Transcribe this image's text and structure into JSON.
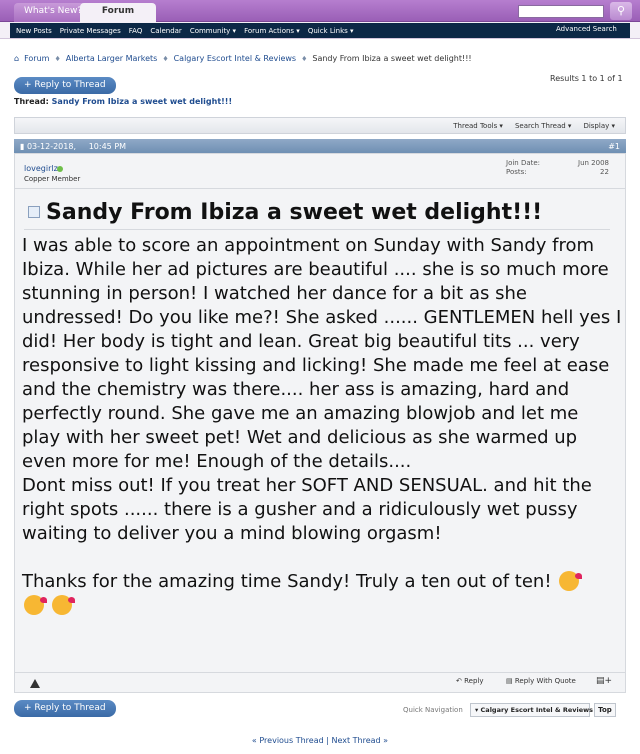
{
  "topbar": {
    "whats_new": "What's New?",
    "forum_tab": "Forum",
    "search_icon": "search-icon"
  },
  "subnav": {
    "items": [
      "New Posts",
      "Private Messages",
      "FAQ",
      "Calendar",
      "Community ▾",
      "Forum Actions ▾",
      "Quick Links ▾"
    ],
    "advanced_search": "Advanced Search"
  },
  "breadcrumb": {
    "items": [
      "Forum",
      "Alberta Larger Markets",
      "Calgary Escort Intel & Reviews"
    ],
    "current": "Sandy From Ibiza a sweet wet delight!!!"
  },
  "results": "Results 1 to 1 of 1",
  "reply_button": "+ Reply to Thread",
  "thread": {
    "label": "Thread:",
    "title": "Sandy From Ibiza a sweet wet delight!!!"
  },
  "toolbar": {
    "thread_tools": "Thread Tools ▾",
    "search_thread": "Search Thread ▾",
    "display": "Display ▾"
  },
  "post": {
    "date": "03-12-2018,",
    "time": "10:45 PM",
    "number": "#1",
    "username": "lovegirlz",
    "user_title": "Copper Member",
    "join_label": "Join Date:",
    "join_value": "Jun 2008",
    "posts_label": "Posts:",
    "posts_value": "22",
    "title": "Sandy From Ibiza a sweet wet delight!!!",
    "body1": "I was able to score an appointment on Sunday with Sandy from Ibiza. While her ad pictures are beautiful .... she is so much more stunning in person! I watched her dance for a bit as she undressed! Do you like me?! She asked ...... GENTLEMEN hell yes I did! Her body is tight and lean. Great big beautiful tits ... very responsive to light kissing and licking! She made me feel at ease and the chemistry was there.... her ass is amazing, hard and perfectly round. She gave me an amazing blowjob and let me play with her sweet pet! Wet and delicious as she warmed up even more for me! Enough of the details....",
    "body2": "Dont miss out! If you treat her SOFT AND SENSUAL. and hit the right spots ...... there is a gusher and a ridiculously wet pussy waiting to deliver you a mind blowing orgasm!",
    "body3": "Thanks for the amazing time Sandy! Truly a ten out of ten!",
    "reply": "Reply",
    "reply_quote": "Reply With Quote"
  },
  "bottom": {
    "quick_nav_label": "Quick Navigation",
    "quick_nav_value": "Calgary Escort Intel & Reviews",
    "top": "Top",
    "prev": "« Previous Thread",
    "sep": " | ",
    "next": "Next Thread »"
  }
}
